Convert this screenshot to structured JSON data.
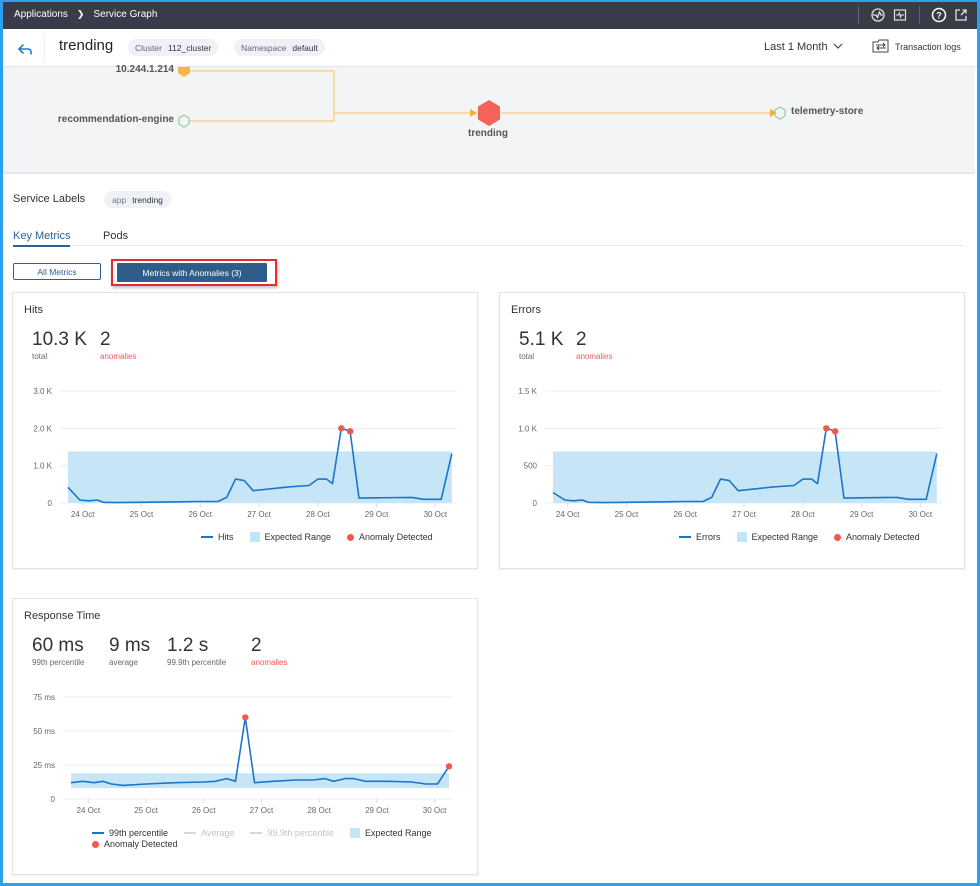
{
  "topbar": {
    "breadcrumb": [
      "Applications",
      "Service Graph"
    ],
    "icons": [
      "health-check-icon",
      "monitor-icon",
      "help-icon",
      "external-link-icon"
    ]
  },
  "header": {
    "title": "trending",
    "cluster_key": "Cluster",
    "cluster_value": "112_cluster",
    "namespace_key": "Namespace",
    "namespace_value": "default",
    "time_range": "Last 1 Month",
    "transaction_logs": "Transaction logs"
  },
  "graph": {
    "nodes": [
      {
        "label": "10.244.1.214",
        "type": "ip",
        "color": "#f9b44a"
      },
      {
        "label": "recommendation-engine",
        "type": "service",
        "color": "#8fd49a"
      },
      {
        "label": "trending",
        "type": "selected-service",
        "color": "#f5625a"
      },
      {
        "label": "telemetry-store",
        "type": "service",
        "color": "#8fd49a"
      }
    ],
    "edge_color": "#f7c978"
  },
  "service_labels": {
    "title": "Service Labels",
    "labels": [
      {
        "key": "app",
        "value": "trending"
      }
    ]
  },
  "tabs": [
    {
      "label": "Key Metrics",
      "active": true
    },
    {
      "label": "Pods",
      "active": false
    }
  ],
  "filters": {
    "all_metrics": "All Metrics",
    "with_anomalies": "Metrics with Anomalies (3)"
  },
  "colors": {
    "line": "#1d75c8",
    "expected_range": "#c3e5f8",
    "anomaly": "#f4574f",
    "accent": "#2c6196"
  },
  "cards": {
    "hits": {
      "title": "Hits",
      "stats": [
        {
          "value": "10.3 K",
          "label": "total"
        },
        {
          "value": "2",
          "label": "anomalies",
          "red": true
        }
      ],
      "legend": [
        "Hits",
        "Expected Range",
        "Anomaly Detected"
      ]
    },
    "errors": {
      "title": "Errors",
      "stats": [
        {
          "value": "5.1 K",
          "label": "total"
        },
        {
          "value": "2",
          "label": "anomalies",
          "red": true
        }
      ],
      "legend": [
        "Errors",
        "Expected Range",
        "Anomaly Detected"
      ]
    },
    "response": {
      "title": "Response Time",
      "stats": [
        {
          "value": "60 ms",
          "label": "99th percentile"
        },
        {
          "value": "9 ms",
          "label": "average"
        },
        {
          "value": "1.2 s",
          "label": "99.9th percentile"
        },
        {
          "value": "2",
          "label": "anomalies",
          "red": true
        }
      ],
      "legend": [
        "99th percentile",
        "Average",
        "99.9th percentile",
        "Expected Range",
        "Anomaly Detected"
      ]
    }
  },
  "chart_data": [
    {
      "id": "hits",
      "type": "line",
      "title": "Hits",
      "x_ticks": [
        "24 Oct",
        "25 Oct",
        "26 Oct",
        "27 Oct",
        "28 Oct",
        "29 Oct",
        "30 Oct"
      ],
      "x_range": [
        23.75,
        30.3
      ],
      "ylim": [
        0,
        3000
      ],
      "y_ticks": [
        0,
        1000,
        2000,
        3000
      ],
      "y_tick_labels": [
        "0",
        "1.0 K",
        "2.0 K",
        "3.0 K"
      ],
      "expected_range": [
        0,
        1380
      ],
      "series": [
        {
          "name": "Hits",
          "x": [
            23.75,
            23.95,
            24.1,
            24.25,
            24.35,
            24.6,
            25.0,
            25.5,
            26.0,
            26.3,
            26.45,
            26.6,
            26.75,
            26.9,
            27.2,
            27.5,
            27.85,
            28.0,
            28.15,
            28.25,
            28.4,
            28.55,
            28.7,
            29.0,
            29.6,
            29.8,
            30.1,
            30.28
          ],
          "y": [
            420,
            80,
            60,
            80,
            20,
            10,
            20,
            30,
            40,
            40,
            150,
            640,
            600,
            330,
            380,
            430,
            470,
            640,
            640,
            520,
            2000,
            1920,
            130,
            140,
            150,
            100,
            100,
            1320
          ]
        }
      ],
      "anomalies": [
        {
          "x": 28.4,
          "y": 2000
        },
        {
          "x": 28.55,
          "y": 1920
        }
      ],
      "legend": [
        "Hits",
        "Expected Range",
        "Anomaly Detected"
      ],
      "legend_position": "bottom-right"
    },
    {
      "id": "errors",
      "type": "line",
      "title": "Errors",
      "x_ticks": [
        "24 Oct",
        "25 Oct",
        "26 Oct",
        "27 Oct",
        "28 Oct",
        "29 Oct",
        "30 Oct"
      ],
      "x_range": [
        23.75,
        30.3
      ],
      "ylim": [
        0,
        1500
      ],
      "y_ticks": [
        0,
        500,
        1000,
        1500
      ],
      "y_tick_labels": [
        "0",
        "500",
        "1.0 K",
        "1.5 K"
      ],
      "expected_range": [
        0,
        690
      ],
      "series": [
        {
          "name": "Errors",
          "x": [
            23.75,
            23.95,
            24.1,
            24.25,
            24.35,
            24.6,
            25.0,
            25.5,
            26.0,
            26.3,
            26.45,
            26.6,
            26.75,
            26.9,
            27.2,
            27.5,
            27.85,
            28.0,
            28.15,
            28.25,
            28.4,
            28.55,
            28.7,
            29.0,
            29.6,
            29.8,
            30.1,
            30.28
          ],
          "y": [
            140,
            40,
            30,
            40,
            10,
            5,
            10,
            15,
            20,
            20,
            75,
            320,
            300,
            165,
            190,
            215,
            235,
            320,
            320,
            260,
            1000,
            960,
            65,
            70,
            75,
            50,
            50,
            660
          ]
        }
      ],
      "anomalies": [
        {
          "x": 28.4,
          "y": 1000
        },
        {
          "x": 28.55,
          "y": 960
        }
      ],
      "legend": [
        "Errors",
        "Expected Range",
        "Anomaly Detected"
      ],
      "legend_position": "bottom-right"
    },
    {
      "id": "response",
      "type": "line",
      "title": "Response Time",
      "x_ticks": [
        "24 Oct",
        "25 Oct",
        "26 Oct",
        "27 Oct",
        "28 Oct",
        "29 Oct",
        "30 Oct"
      ],
      "x_range": [
        23.7,
        30.25
      ],
      "ylim": [
        0,
        75
      ],
      "y_ticks": [
        0,
        25,
        50,
        75
      ],
      "y_tick_labels": [
        "0",
        "25 ms",
        "50 ms",
        "75 ms"
      ],
      "expected_range": [
        8,
        19
      ],
      "series": [
        {
          "name": "99th percentile",
          "x": [
            23.7,
            23.9,
            24.1,
            24.25,
            24.4,
            24.6,
            25.0,
            25.5,
            26.0,
            26.2,
            26.4,
            26.55,
            26.72,
            26.88,
            27.2,
            27.6,
            27.9,
            28.1,
            28.25,
            28.45,
            28.6,
            28.8,
            29.2,
            29.6,
            29.85,
            30.05,
            30.25
          ],
          "y": [
            12,
            13,
            12,
            13,
            11,
            10,
            11,
            12,
            12.5,
            13,
            15,
            13,
            60,
            12,
            13,
            14,
            14,
            15,
            13,
            15,
            15,
            13,
            13,
            12.5,
            11,
            11,
            24
          ]
        },
        {
          "name": "Average",
          "hidden": true
        },
        {
          "name": "99.9th percentile",
          "hidden": true
        }
      ],
      "anomalies": [
        {
          "x": 26.72,
          "y": 60
        },
        {
          "x": 30.25,
          "y": 24
        }
      ],
      "legend": [
        "99th percentile",
        "Average",
        "99.9th percentile",
        "Expected Range",
        "Anomaly Detected"
      ],
      "legend_position": "bottom"
    }
  ]
}
